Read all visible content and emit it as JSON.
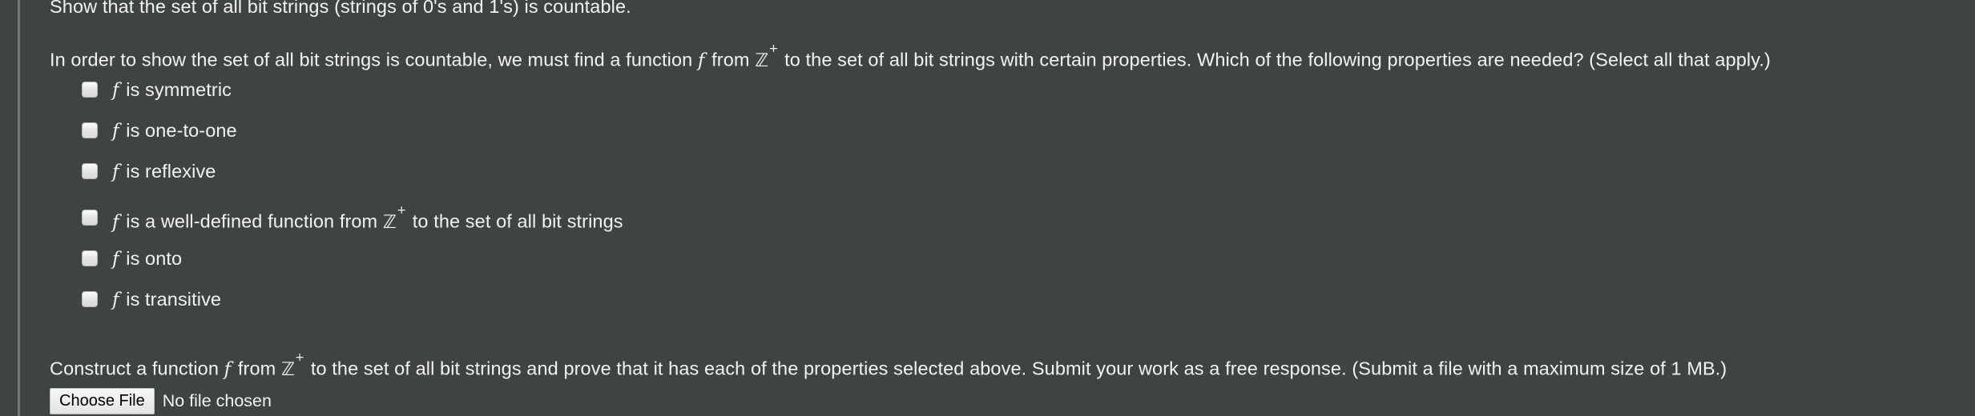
{
  "question": {
    "prompt": "Show that the set of all bit strings (strings of 0's and 1's) is countable.",
    "instruction_pre": "In order to show the set of all bit strings is countable, we must find a function ",
    "instruction_var": "f",
    "instruction_mid": " from ",
    "instruction_set": "ℤ",
    "instruction_sup": "+",
    "instruction_post": " to the set of all bit strings with certain properties. Which of the following properties are needed? (Select all that apply.)"
  },
  "options": [
    {
      "var": "f",
      "text": " is symmetric",
      "checked": false
    },
    {
      "var": "f",
      "text": " is one-to-one",
      "checked": false
    },
    {
      "var": "f",
      "text": " is reflexive",
      "checked": false
    },
    {
      "var": "f",
      "text": " is a well-defined function from ℤ⁺ to the set of all bit strings",
      "checked": false,
      "has_math": true,
      "pre": " is a well-defined function from ",
      "post": " to the set of all bit strings"
    },
    {
      "var": "f",
      "text": " is onto",
      "checked": false
    },
    {
      "var": "f",
      "text": " is transitive",
      "checked": false
    }
  ],
  "closing": {
    "pre": "Construct a function ",
    "var": "f",
    "mid": " from ",
    "set": "ℤ",
    "sup": "+",
    "post": " to the set of all bit strings and prove that it has each of the properties selected above. Submit your work as a free response. (Submit a file with a maximum size of 1 MB.)"
  },
  "file_upload": {
    "button_label": "Choose File",
    "status": "No file chosen"
  },
  "colors": {
    "background": "#3f4443",
    "text": "#f2f2f0",
    "rule": "#72767a",
    "checkbox_fill": "#e3e3e3",
    "button_face": "#ededed",
    "button_text": "#000000"
  }
}
